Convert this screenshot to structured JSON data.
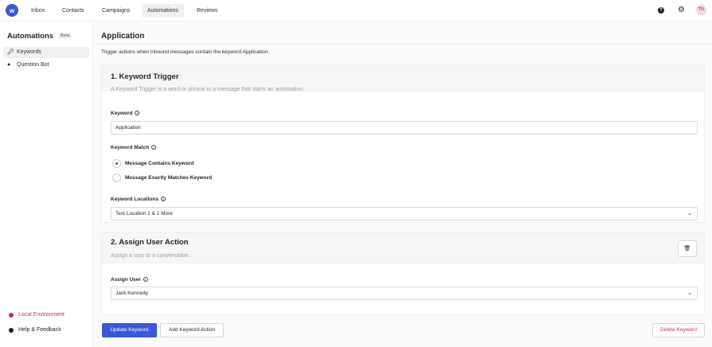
{
  "topbar": {
    "logo_icon": "brand-logo-icon",
    "nav": [
      "Inbox",
      "Contacts",
      "Campaigns",
      "Automations",
      "Reviews"
    ],
    "active_nav": "Automations",
    "help_icon": "help-circle-icon",
    "settings_icon": "gear-icon",
    "avatar_initials": "TU"
  },
  "sidebar": {
    "title": "Automations",
    "badge": "Beta",
    "items": [
      {
        "label": "Keywords",
        "icon": "key-icon",
        "active": true
      },
      {
        "label": "Question Bot",
        "icon": "question-circle-icon",
        "active": false
      }
    ],
    "environment_label": "Local Environment",
    "help_label": "Help & Feedback"
  },
  "main": {
    "title": "Application",
    "description": "Trigger actions when inbound messages contain the keyword Application.",
    "keyword_trigger": {
      "title": "1. Keyword Trigger",
      "subtitle": "A Keyword Trigger is a word or phrase in a message that starts an automation.",
      "keyword_label": "Keyword",
      "keyword_value": "Application",
      "match_label": "Keyword Match",
      "match_options": [
        "Message Contains Keyword",
        "Message Exactly Matches Keyword"
      ],
      "match_selected": "Message Contains Keyword",
      "locations_label": "Keyword Locations",
      "locations_value": "Test Location 1 & 1 More"
    },
    "assign_user": {
      "title": "2. Assign User Action",
      "subtitle": "Assign a user to a conversation.",
      "user_label": "Assign User",
      "user_value": "Jack Kennedy",
      "delete_icon": "trash-icon"
    },
    "footer": {
      "update_label": "Update Keyword",
      "add_action_label": "Add Keyword Action",
      "delete_label": "Delete Keyword"
    }
  },
  "colors": {
    "brand": "#3b57d8",
    "danger": "#c2364a"
  }
}
